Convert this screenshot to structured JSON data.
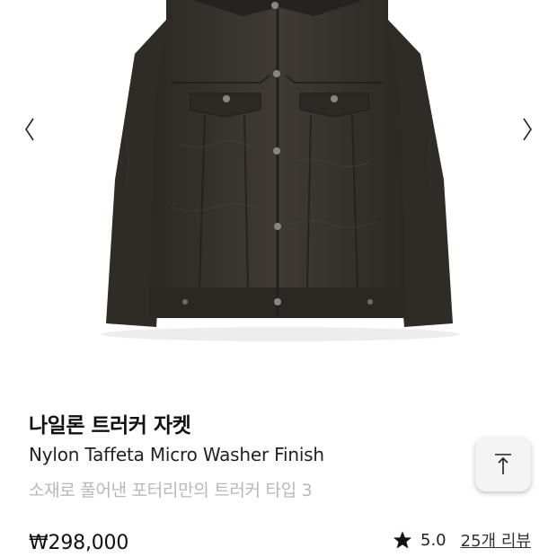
{
  "carousel": {
    "prev_icon": "chevron-left-icon",
    "next_icon": "chevron-right-icon"
  },
  "product": {
    "name_ko": "나일론 트러커 자켓",
    "name_en": "Nylon Taffeta Micro Washer Finish",
    "subtitle": "소재로 풀어낸 포터리만의 트러커 타입 3",
    "price": "₩298,000",
    "rating_icon": "star-icon",
    "rating": "5.0",
    "review_link": "25개 리뷰"
  },
  "scroll_top": {
    "icon": "arrow-up-to-top-icon"
  },
  "colors": {
    "jacket": "#3b3631",
    "jacket_shadow": "#2a2622",
    "snap": "#8a8580",
    "subtitle_text": "#b8b8b8",
    "button_bg": "#f4f4f4"
  }
}
